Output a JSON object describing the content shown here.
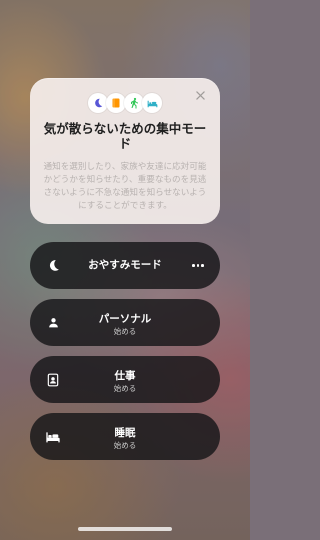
{
  "intro": {
    "title": "気が散らないための集中モード",
    "description": "通知を選別したり、家族や友達に応対可能かどうかを知らせたり、重要なものを見逃さないように不急な通知を知らせないようにすることができます。",
    "icons": [
      "moon-icon",
      "book-icon",
      "running-person-icon",
      "bed-icon"
    ],
    "close_icon": "close-icon"
  },
  "modes": [
    {
      "label": "おやすみモード",
      "sub": "",
      "icon": "moon-icon",
      "has_more": true
    },
    {
      "label": "パーソナル",
      "sub": "始める",
      "icon": "person-icon"
    },
    {
      "label": "仕事",
      "sub": "始める",
      "icon": "id-badge-icon"
    },
    {
      "label": "睡眠",
      "sub": "始める",
      "icon": "bed-icon"
    }
  ],
  "colors": {
    "moon_chip": "#5856d6",
    "book_chip": "#ff9500",
    "run_chip": "#34c759",
    "bed_chip": "#30b0c7"
  }
}
